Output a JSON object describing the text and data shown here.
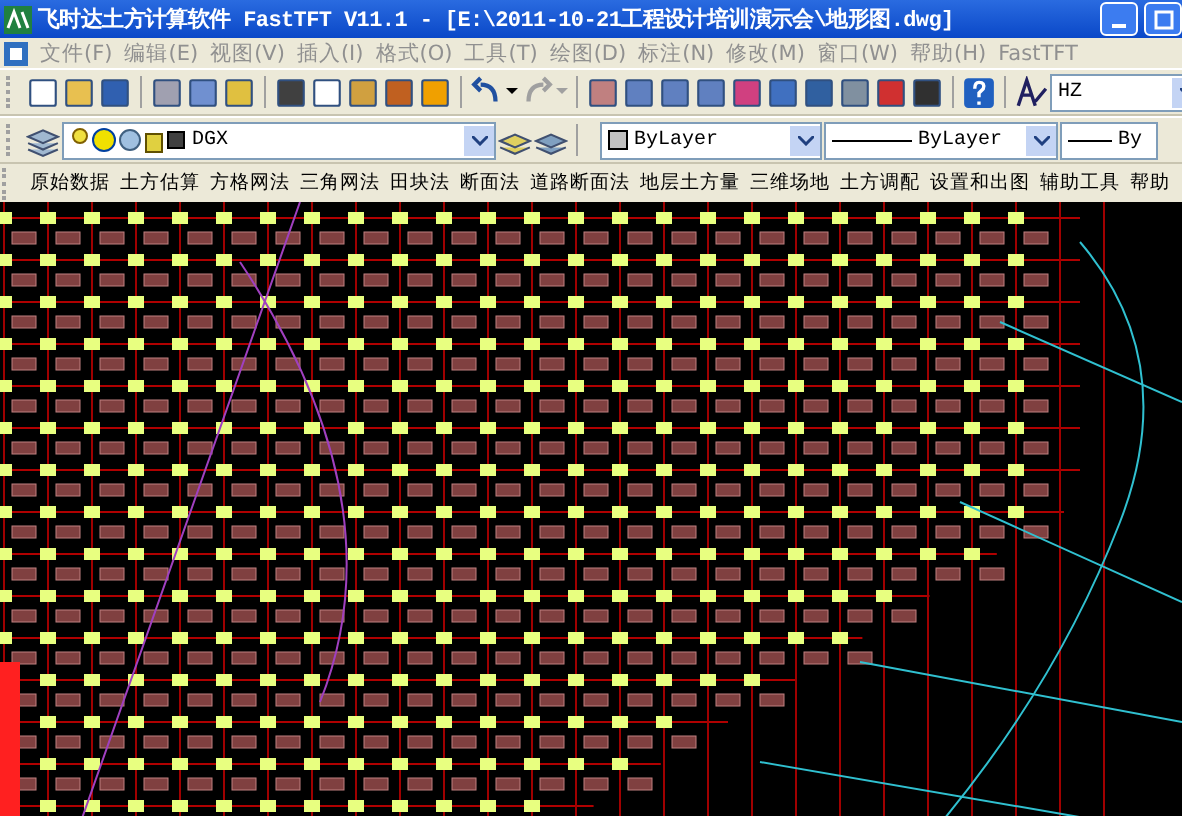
{
  "window": {
    "title": "飞时达土方计算软件 FastTFT V11.1 - [E:\\2011-10-21工程设计培训演示会\\地形图.dwg]"
  },
  "menu_bar": {
    "items": [
      {
        "label": "文件(F)"
      },
      {
        "label": "编辑(E)"
      },
      {
        "label": "视图(V)"
      },
      {
        "label": "插入(I)"
      },
      {
        "label": "格式(O)"
      },
      {
        "label": "工具(T)"
      },
      {
        "label": "绘图(D)"
      },
      {
        "label": "标注(N)"
      },
      {
        "label": "修改(M)"
      },
      {
        "label": "窗口(W)"
      },
      {
        "label": "帮助(H)"
      },
      {
        "label": "FastTFT"
      }
    ]
  },
  "text_style": {
    "value": "HZ"
  },
  "layer_combo": {
    "value": "DGX"
  },
  "property_combos": [
    {
      "kind": "color",
      "value": "ByLayer"
    },
    {
      "kind": "linetype",
      "value": "ByLayer"
    },
    {
      "kind": "lineweight",
      "value": "By"
    }
  ],
  "plugin_menu": {
    "items": [
      {
        "label": "原始数据"
      },
      {
        "label": "土方估算"
      },
      {
        "label": "方格网法"
      },
      {
        "label": "三角网法"
      },
      {
        "label": "田块法"
      },
      {
        "label": "断面法"
      },
      {
        "label": "道路断面法"
      },
      {
        "label": "地层土方量"
      },
      {
        "label": "三维场地"
      },
      {
        "label": "土方调配"
      },
      {
        "label": "设置和出图"
      },
      {
        "label": "辅助工具"
      },
      {
        "label": "帮助"
      }
    ]
  }
}
